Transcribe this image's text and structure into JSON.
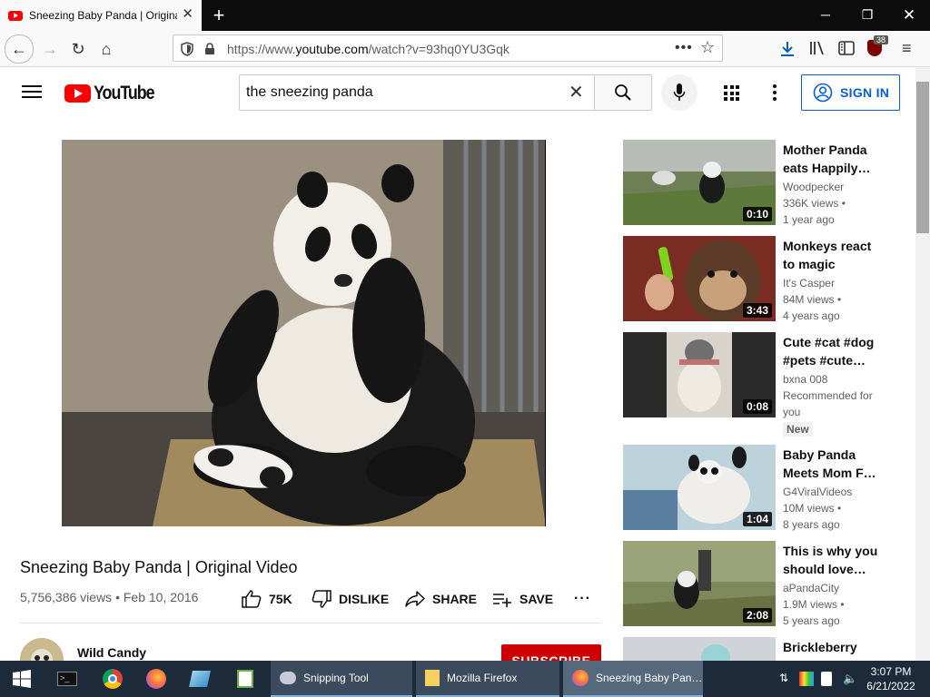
{
  "browser": {
    "tab_title": "Sneezing Baby Panda | Original Video - YouTube",
    "url_prefix": "https://www.",
    "url_domain": "youtube.com",
    "url_rest": "/watch?v=93hq0YU3Gqk",
    "extension_badge": "38"
  },
  "header": {
    "logo_text": "YouTube",
    "search_value": "the sneezing panda",
    "sign_in_label": "SIGN IN"
  },
  "video": {
    "title": "Sneezing Baby Panda | Original Video",
    "meta": "5,756,386 views • Feb 10, 2016",
    "likes": "75K",
    "dislike_label": "DISLIKE",
    "share_label": "SHARE",
    "save_label": "SAVE",
    "channel": "Wild Candy",
    "subscribe_label": "SUBSCRIBE"
  },
  "suggestions": [
    {
      "title": "Mother Panda eats Happily…",
      "channel": "Woodpecker",
      "views": "336K views •",
      "age": "1 year ago",
      "duration": "0:10"
    },
    {
      "title": "Monkeys react to magic",
      "channel": "It's Casper",
      "views": "84M views •",
      "age": "4 years ago",
      "duration": "3:43"
    },
    {
      "title": "Cute #cat #dog #pets #cute…",
      "channel": "bxna 008",
      "views": "Recommended for",
      "age": "you",
      "duration": "0:08",
      "badge": "New"
    },
    {
      "title": "Baby Panda Meets Mom F…",
      "channel": "G4ViralVideos",
      "views": "10M views •",
      "age": "8 years ago",
      "duration": "1:04"
    },
    {
      "title": "This is why you should love…",
      "channel": "aPandaCity",
      "views": "1.9M views •",
      "age": "5 years ago",
      "duration": "2:08"
    },
    {
      "title": "Brickleberry"
    }
  ],
  "taskbar": {
    "tasks": [
      "Snipping Tool",
      "Mozilla Firefox",
      "Sneezing Baby Pan…"
    ],
    "time": "3:07 PM",
    "date": "6/21/2022"
  },
  "colors": {
    "accent": "#065fd4",
    "brand_red": "#ff0000",
    "subscribe": "#cc0000"
  }
}
